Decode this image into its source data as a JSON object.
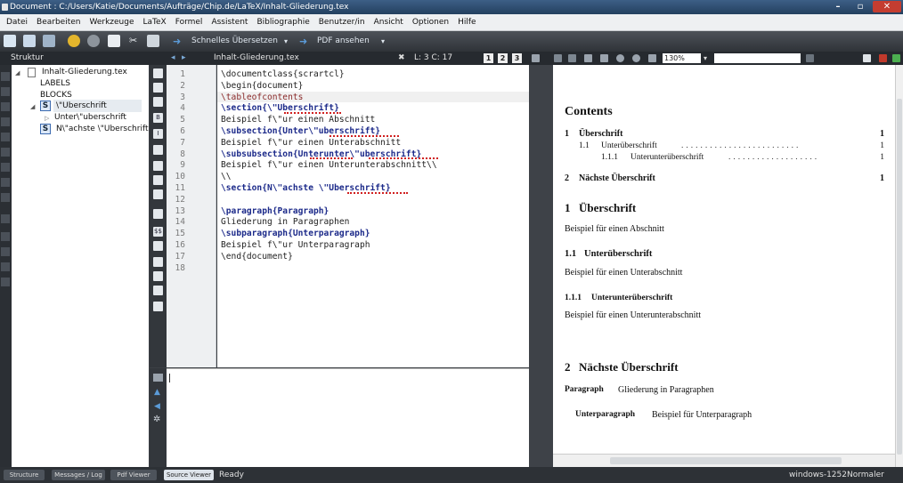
{
  "window": {
    "title": "Document : C:/Users/Katie/Documents/Aufträge/Chip.de/LaTeX/Inhalt-Gliederung.tex"
  },
  "menu": [
    "Datei",
    "Bearbeiten",
    "Werkzeuge",
    "LaTeX",
    "Formel",
    "Assistent",
    "Bibliographie",
    "Benutzer/in",
    "Ansicht",
    "Optionen",
    "Hilfe"
  ],
  "toolbar": {
    "quick_build": "Schnelles Übersetzen",
    "view_pdf": "PDF ansehen"
  },
  "structure": {
    "header": "Struktur",
    "file": "Inhalt-Gliederung.tex",
    "labels": "LABELS",
    "blocks": "BLOCKS",
    "section1": "\\\"Uberschrift",
    "subsection": "Unter\\\"uberschrift",
    "section2": "N\\\"achste \\\"Uberschrift"
  },
  "editor": {
    "tab": "Inhalt-Gliederung.tex",
    "position": "L: 3 C: 17",
    "views": [
      "1",
      "2",
      "3"
    ],
    "line_numbers": [
      "1",
      "2",
      "3",
      "4",
      "5",
      "6",
      "7",
      "8",
      "9",
      "10",
      "11",
      "12",
      "13",
      "14",
      "15",
      "16",
      "17",
      "18"
    ],
    "lines": [
      "\\documentclass{scrartcl}",
      "\\begin{document}",
      "\\tableofcontents",
      "\\section{\\\"Uberschrift}",
      "Beispiel f\\\"ur einen Abschnitt",
      "\\subsection{Unter\\\"uberschrift}",
      "Beispiel f\\\"ur einen Unterabschnitt",
      "\\subsubsection{Unterunter\\\"uberschrift}",
      "Beispiel f\\\"ur einen Unterunterabschnitt\\\\",
      "\\\\",
      "\\section{N\\\"achste \\\"Uberschrift}",
      "",
      "\\paragraph{Paragraph}",
      "Gliederung in Paragraphen",
      "\\subparagraph{Unterparagraph}",
      "Beispiel f\\\"ur Unterparagraph",
      "\\end{document}",
      ""
    ]
  },
  "pdf_viewer": {
    "zoom": "130%",
    "contents_title": "Contents",
    "toc": {
      "s1_num": "1",
      "s1": "Überschrift",
      "s11_num": "1.1",
      "s11": "Unterüberschrift",
      "s111_num": "1.1.1",
      "s111": "Unterunterüberschrift",
      "s2_num": "2",
      "s2": "Nächste Überschrift"
    },
    "body": {
      "h1_num": "1",
      "h1": "Überschrift",
      "p1": "Beispiel für einen Abschnitt",
      "h11_num": "1.1",
      "h11": "Unterüberschrift",
      "p11": "Beispiel für einen Unterabschnitt",
      "h111_num": "1.1.1",
      "h111": "Unterunterüberschrift",
      "p111": "Beispiel für einen Unterunterabschnitt",
      "h2_num": "2",
      "h2": "Nächste Überschrift",
      "para_title": "Paragraph",
      "para_text": "Gliederung in Paragraphen",
      "subpara_title": "Unterparagraph",
      "subpara_text": "Beispiel für Unterparagraph"
    }
  },
  "status": {
    "tabs": [
      "Structure",
      "Messages / Log",
      "Pdf Viewer",
      "Source Viewer"
    ],
    "ready": "Ready",
    "encoding": "windows-1252",
    "mode": "Normaler Modus"
  },
  "colors": {
    "accent": "#3d5f86",
    "spell_error": "#d02020"
  }
}
